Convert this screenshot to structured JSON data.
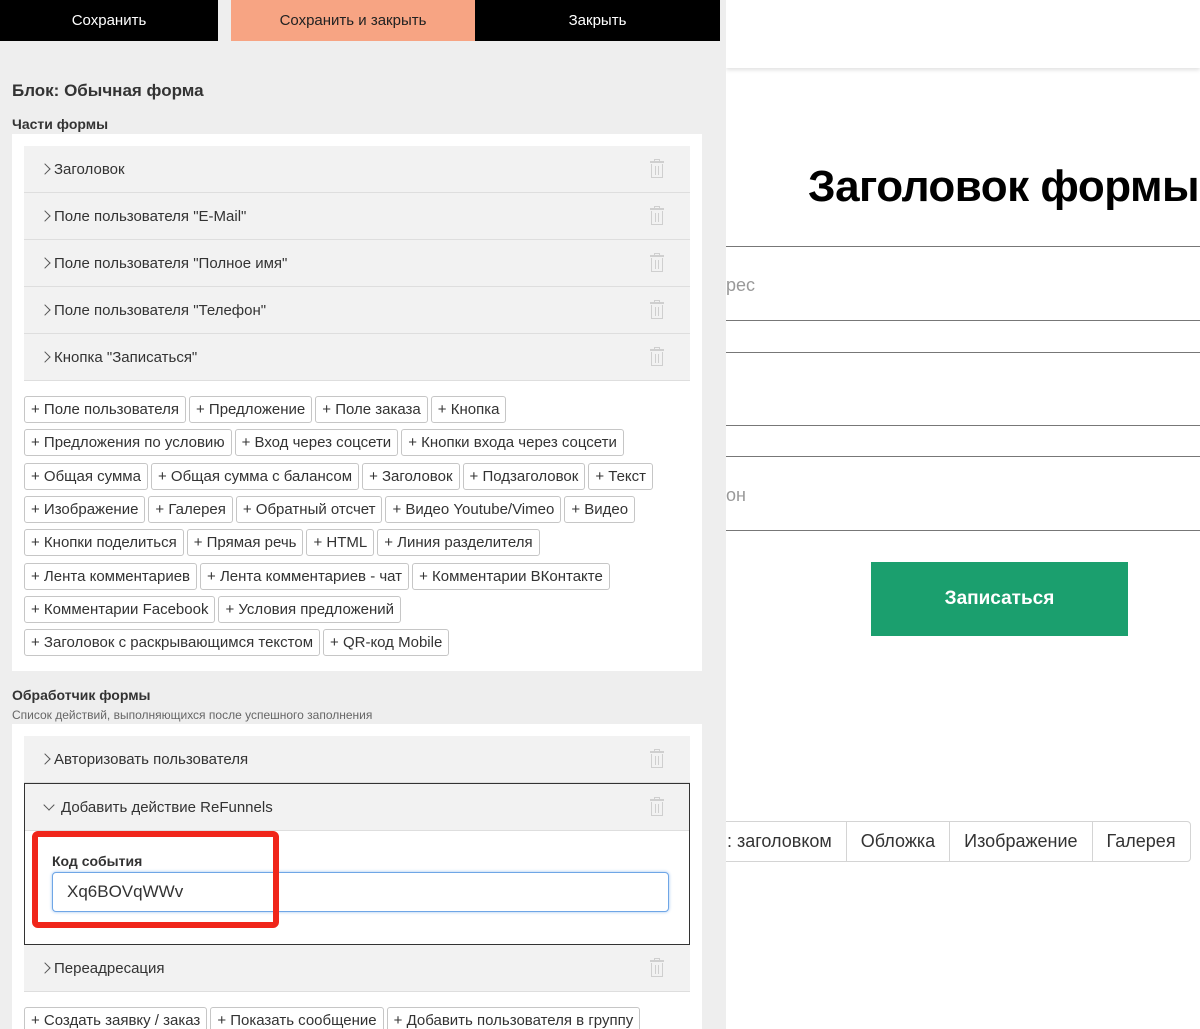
{
  "toolbar": {
    "save": "Сохранить",
    "save_close": "Сохранить и закрыть",
    "close": "Закрыть"
  },
  "block_title": "Блок: Обычная форма",
  "parts_title": "Части формы",
  "parts": [
    "Заголовок",
    "Поле пользователя \"E-Mail\"",
    "Поле пользователя \"Полное имя\"",
    "Поле пользователя \"Телефон\"",
    "Кнопка \"Записаться\""
  ],
  "add_parts": [
    [
      "+ Поле пользователя",
      "+ Предложение",
      "+ Поле заказа",
      "+ Кнопка"
    ],
    [
      "+ Предложения по условию",
      "+ Вход через соцсети",
      "+ Кнопки входа через соцсети"
    ],
    [
      "+ Общая сумма",
      "+ Общая сумма с балансом",
      "+ Заголовок",
      "+ Подзаголовок",
      "+ Текст"
    ],
    [
      "+ Изображение",
      "+ Галерея",
      "+ Обратный отсчет",
      "+ Видео Youtube/Vimeo",
      "+ Видео"
    ],
    [
      "+ Кнопки поделиться",
      "+ Прямая речь",
      "+ HTML",
      "+ Линия разделителя"
    ],
    [
      "+ Лента комментариев",
      "+ Лента комментариев - чат",
      "+ Комментарии ВКонтакте"
    ],
    [
      "+ Комментарии Facebook",
      "+ Условия предложений"
    ],
    [
      "+ Заголовок с раскрывающимся текстом",
      "+ QR-код Mobile"
    ]
  ],
  "handler": {
    "title": "Обработчик формы",
    "subtitle": "Список действий, выполняющихся после успешного заполнения",
    "actions": {
      "authorize": "Авторизовать пользователя",
      "refunnels": "Добавить действие ReFunnels",
      "redirect": "Переадресация"
    },
    "event_code_label": "Код события",
    "event_code_value": "Xq6BOVqWWv",
    "add_actions": [
      "+ Создать заявку / заказ",
      "+ Показать сообщение",
      "+ Добавить пользователя в группу"
    ]
  },
  "preview": {
    "form_title": "Заголовок формы",
    "email_placeholder_fragment": "рес",
    "phone_placeholder_fragment": "он",
    "submit_label": "Записаться",
    "tabs": [
      ": заголовком",
      "Обложка",
      "Изображение",
      "Галерея"
    ]
  },
  "colors": {
    "toolbar_bg": "#000000",
    "toolbar_accent": "#f7a483",
    "submit_bg": "#1b9f6e",
    "highlight": "#f0261a"
  }
}
